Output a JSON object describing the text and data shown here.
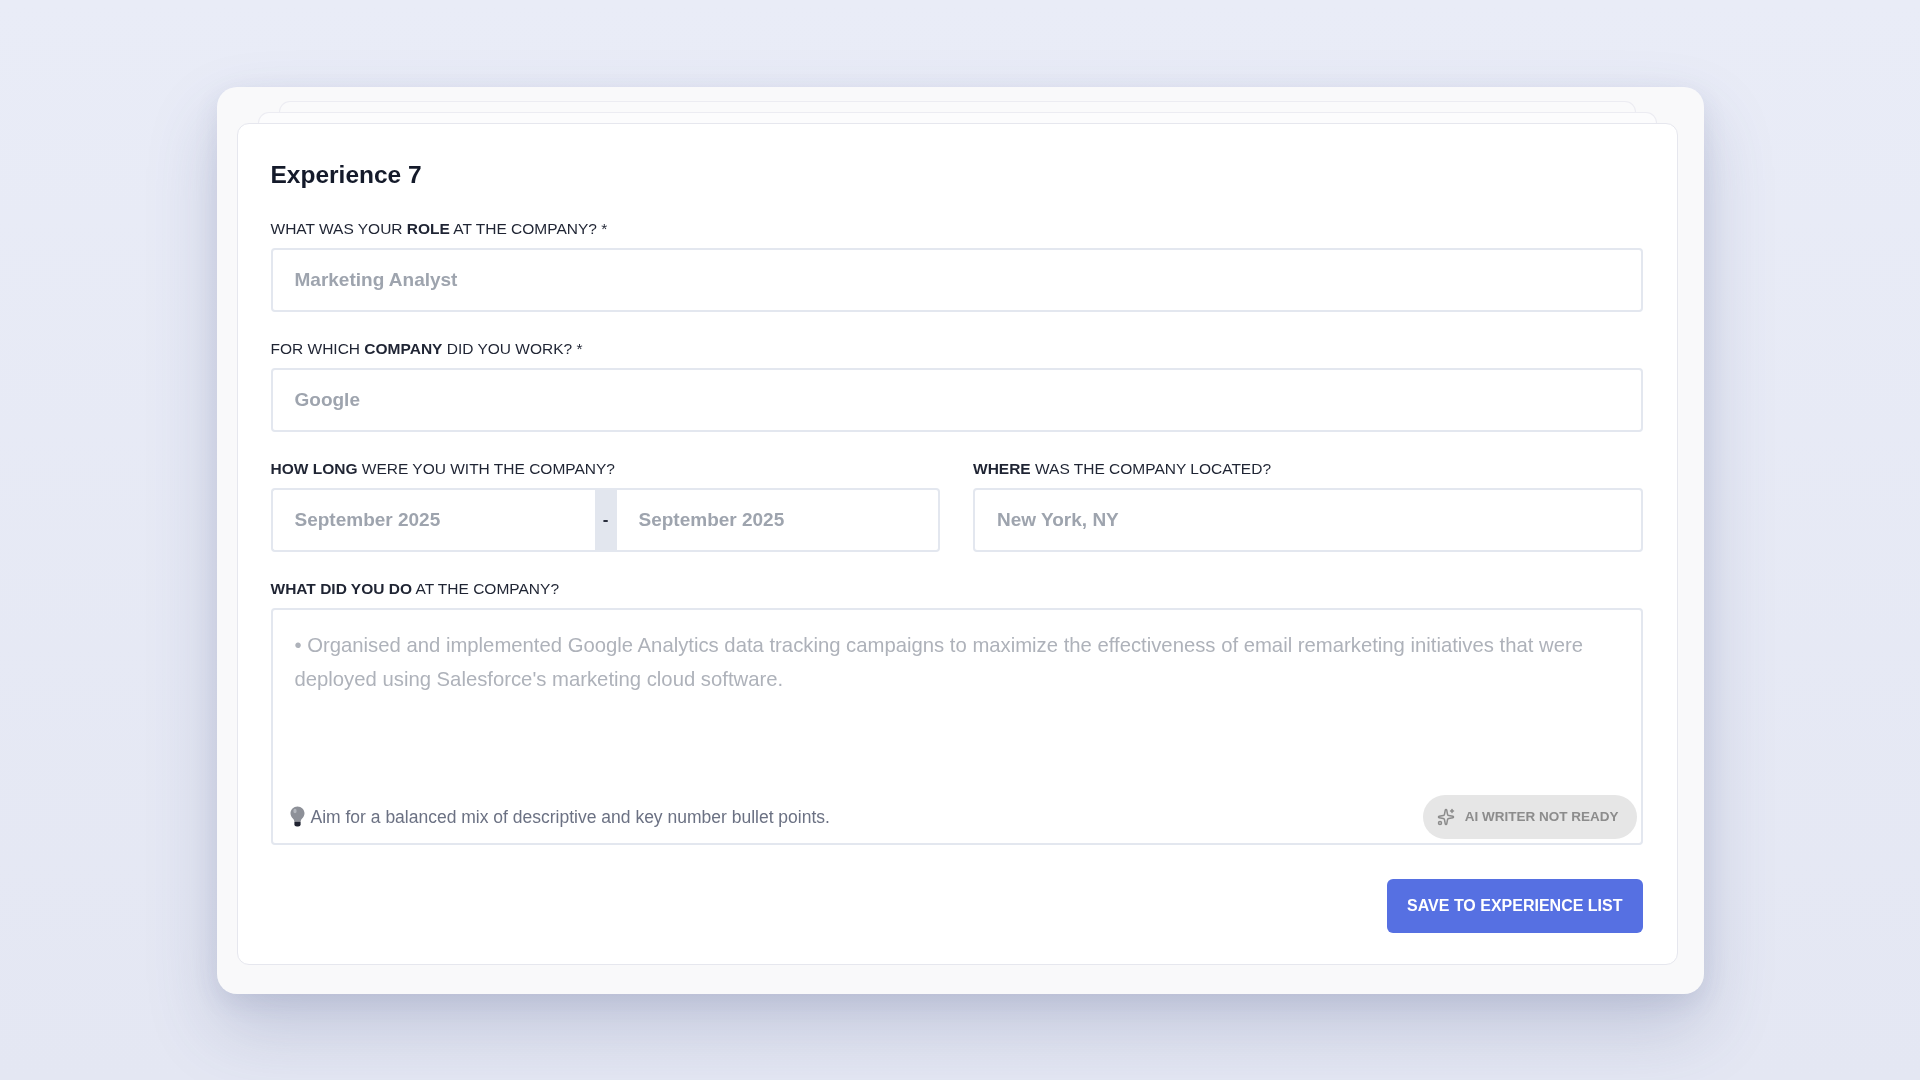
{
  "form": {
    "title": "Experience 7",
    "rows": [
      {
        "fields": [
          {
            "kind": "text",
            "label": "WHAT WAS YOUR **ROLE** AT THE COMPANY? *",
            "placeholder": "Marketing Analyst"
          }
        ]
      },
      {
        "fields": [
          {
            "kind": "text",
            "label": "FOR WHICH **COMPANY** DID YOU WORK? *",
            "placeholder": "Google"
          }
        ]
      },
      {
        "fields": [
          {
            "kind": "date_range",
            "label": "**HOW LONG** WERE YOU WITH THE COMPANY?",
            "start": {
              "placeholder": "September 2025"
            },
            "separator": "-",
            "end": {
              "placeholder": "September 2025"
            }
          },
          {
            "kind": "text",
            "label": "**WHERE** WAS THE COMPANY LOCATED?",
            "placeholder": "New York, NY"
          }
        ]
      },
      {
        "fields": [
          {
            "kind": "textarea",
            "label": "**WHAT DID YOU DO** AT THE COMPANY?",
            "placeholder": "• Organised and implemented Google Analytics data tracking campaigns to maximize the effectiveness of email remarketing initiatives that were deployed using Salesforce's marketing cloud software.",
            "hint": "Aim for a balanced mix of descriptive and key number bullet points.",
            "ai_button": {
              "label": "AI WRITER NOT READY",
              "disabled": true
            }
          }
        ]
      }
    ],
    "save_button": {
      "label": "SAVE TO EXPERIENCE LIST"
    }
  }
}
